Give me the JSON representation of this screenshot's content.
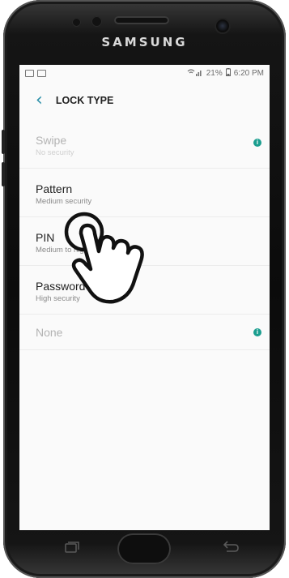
{
  "device": {
    "brand": "SAMSUNG"
  },
  "statusbar": {
    "left_icons": [
      "gallery-icon",
      "screenshot-icon"
    ],
    "signal": "wifi-signal-icon",
    "battery": "21%",
    "time": "6:20 PM"
  },
  "appbar": {
    "title": "LOCK TYPE",
    "back_icon": "back-chevron-icon"
  },
  "options": [
    {
      "title": "Swipe",
      "subtitle": "No security",
      "enabled": false,
      "has_info": true
    },
    {
      "title": "Pattern",
      "subtitle": "Medium security",
      "enabled": true,
      "has_info": false
    },
    {
      "title": "PIN",
      "subtitle": "Medium to high security",
      "enabled": true,
      "has_info": false
    },
    {
      "title": "Password",
      "subtitle": "High security",
      "enabled": true,
      "has_info": false
    },
    {
      "title": "None",
      "subtitle": "",
      "enabled": false,
      "has_info": true
    }
  ],
  "info_glyph": "i",
  "accent_color": "#1b9e8f",
  "gesture": {
    "icon": "tap-hand-icon",
    "target": "PIN"
  }
}
